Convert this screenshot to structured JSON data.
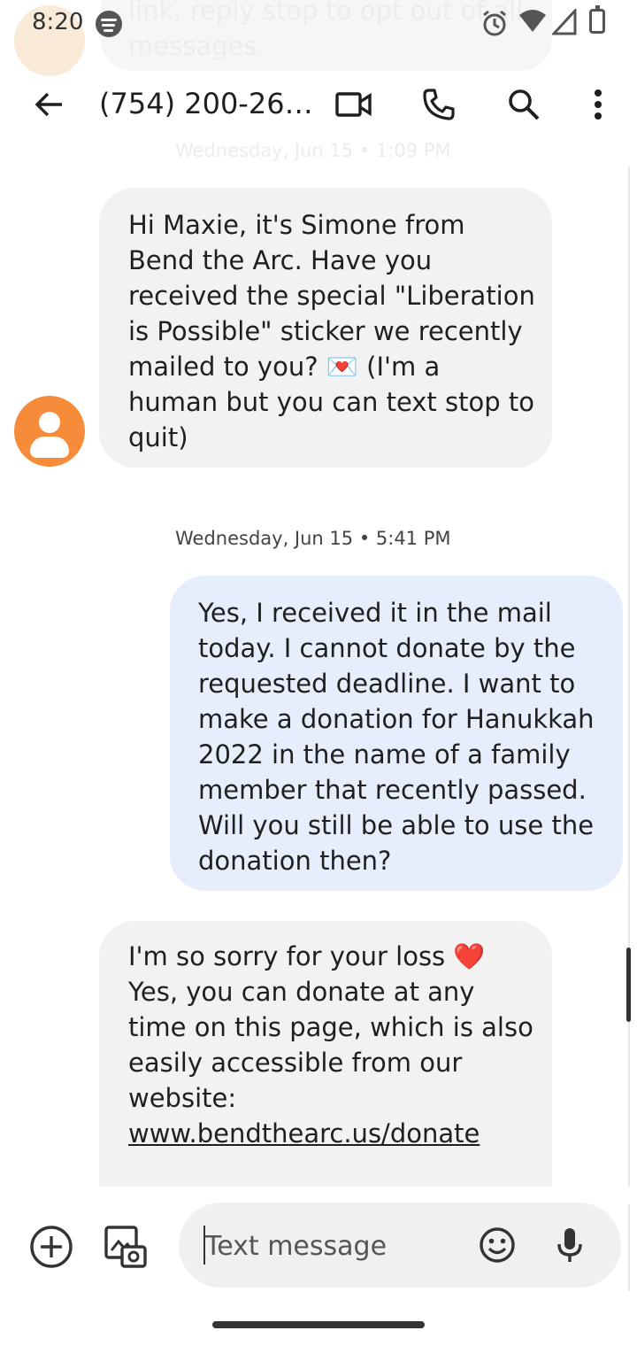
{
  "status_bar": {
    "time": "8:20"
  },
  "notification_peek": {
    "text": "link, reply stop to opt out of all messages"
  },
  "app_bar": {
    "title": "(754) 200-26…"
  },
  "messages": {
    "timestamp_top": "Wednesday, Jun 15 • 1:09 PM",
    "incoming_1": "Hi Maxie, it's Simone from Bend the Arc. Have you received the special \"Liberation is Possible\" sticker we recently mailed to you? 💌 (I'm a human but you can text stop to quit)",
    "timestamp_2": "Wednesday, Jun 15 • 5:41 PM",
    "outgoing_1": "Yes, I received it in the mail today. I cannot donate by the requested deadline. I want to make a donation for Hanukkah 2022 in the name of a family member that recently passed. Will you still be able to use the donation then?",
    "incoming_2_text": "I'm so sorry for your loss ❤️ Yes, you can donate at any time on this page, which is also easily accessible from our website: ",
    "incoming_2_link": "www.bendthearc.us/donate"
  },
  "compose": {
    "placeholder": "Text message"
  },
  "icons": [
    "back-arrow-icon",
    "video-call-icon",
    "phone-icon",
    "search-icon",
    "more-vert-icon",
    "add-circle-icon",
    "gallery-icon",
    "emoji-icon",
    "mic-icon"
  ]
}
